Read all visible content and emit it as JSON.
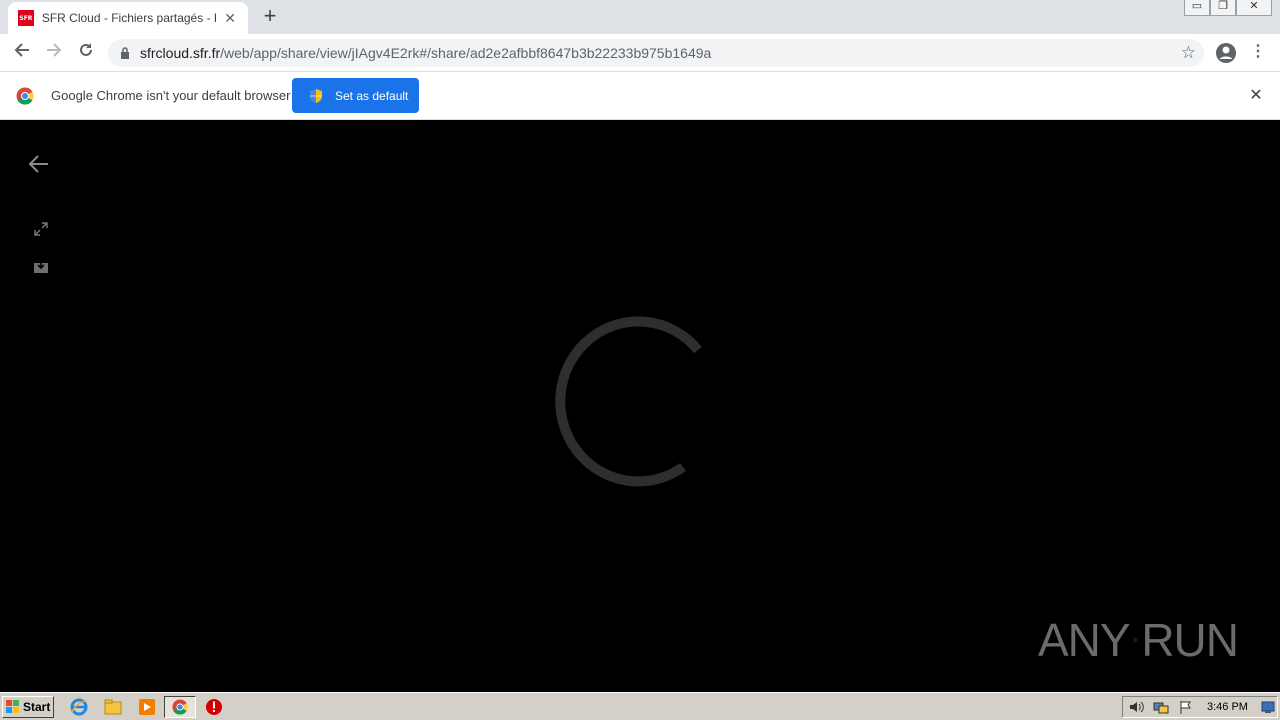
{
  "browser": {
    "tab": {
      "favicon_text": "SFR",
      "title": "SFR Cloud - Fichiers partagés - Liens"
    },
    "address_bar": {
      "domain": "sfrcloud.sfr.fr",
      "path": "/web/app/share/view/jIAgv4E2rk#/share/ad2e2afbbf8647b3b22233b975b1649a"
    },
    "window_buttons": [
      "minimize",
      "restore",
      "close"
    ]
  },
  "infobar": {
    "message": "Google Chrome isn't your default browser",
    "button_label": "Set as default",
    "colors": {
      "button": "#1a73e8"
    }
  },
  "viewer": {
    "background": "#000000",
    "icons": [
      "back-arrow-icon",
      "expand-icon",
      "download-icon"
    ],
    "loading": true
  },
  "watermark": {
    "left": "ANY",
    "right": "RUN"
  },
  "taskbar": {
    "start_label": "Start",
    "apps": [
      "internet-explorer-icon",
      "folder-icon",
      "media-player-icon",
      "chrome-icon",
      "stop-icon"
    ],
    "clock": "3:46 PM"
  }
}
